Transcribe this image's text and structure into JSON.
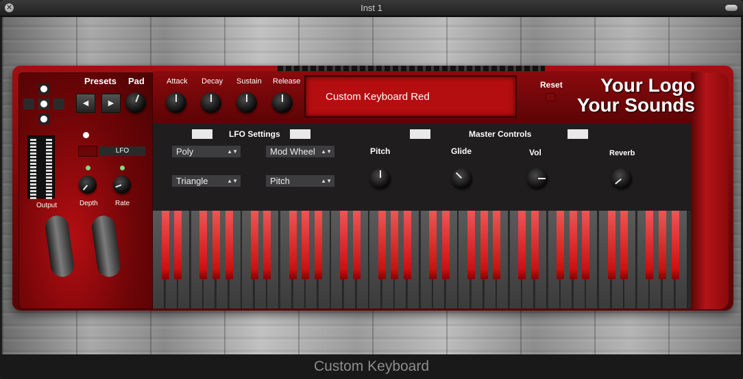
{
  "window": {
    "title": "Inst 1",
    "footer_label": "Custom Keyboard"
  },
  "left_panel": {
    "presets_label": "Presets",
    "pad_label": "Pad",
    "prev_icon": "◀",
    "next_icon": "▶",
    "lfo_label": "LFO",
    "output_label": "Output",
    "depth_label": "Depth",
    "rate_label": "Rate"
  },
  "envelope": {
    "attack_label": "Attack",
    "decay_label": "Decay",
    "sustain_label": "Sustain",
    "release_label": "Release"
  },
  "display": {
    "preset_name": "Custom Keyboard Red"
  },
  "reset_label": "Reset",
  "logo": {
    "line1": "Your Logo",
    "line2": "Your Sounds"
  },
  "lfo_settings": {
    "title": "LFO Settings",
    "mode": "Poly",
    "source": "Mod Wheel",
    "waveform": "Triangle",
    "target": "Pitch"
  },
  "master_controls": {
    "title": "Master Controls",
    "pitch_label": "Pitch",
    "glide_label": "Glide",
    "vol_label": "Vol",
    "reverb_label": "Reverb"
  },
  "colors": {
    "body_red": "#a20f12",
    "key_red": "#cc1111",
    "led_green": "#7fdc7f"
  }
}
